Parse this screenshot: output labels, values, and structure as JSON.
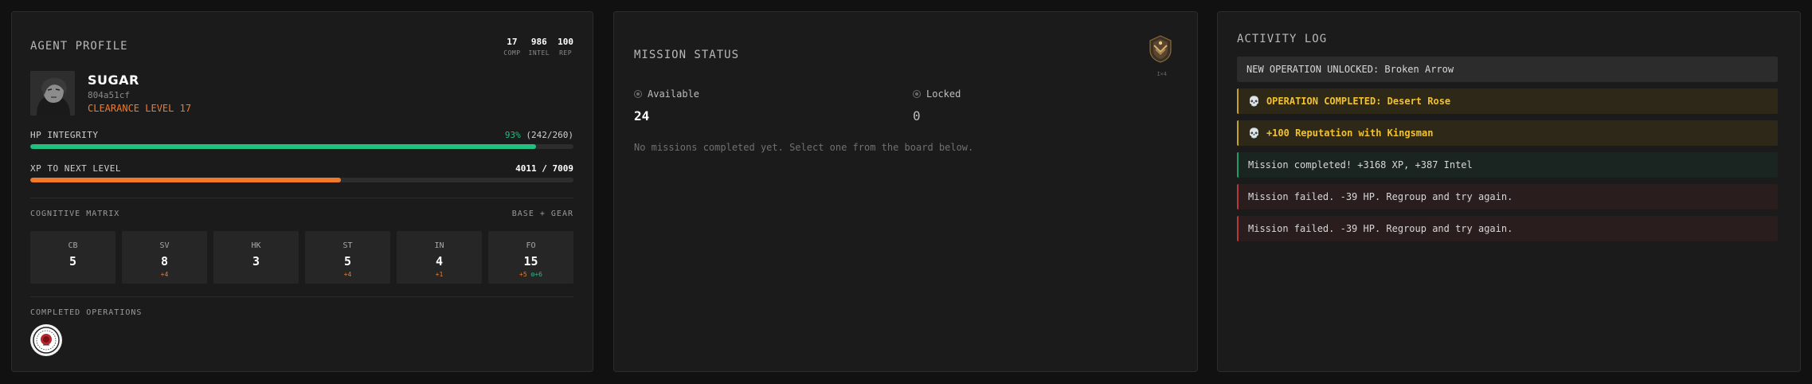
{
  "agent_profile": {
    "title": "AGENT PROFILE",
    "stats": [
      {
        "value": "17",
        "label": "COMP"
      },
      {
        "value": "986",
        "label": "INTEL"
      },
      {
        "value": "100",
        "label": "REP"
      }
    ],
    "name": "SUGAR",
    "agent_id": "804a51cf",
    "clearance": "CLEARANCE LEVEL 17",
    "hp": {
      "label": "HP INTEGRITY",
      "percent": "93%",
      "detail": "(242/260)",
      "fraction": 0.931
    },
    "xp": {
      "label": "XP TO NEXT LEVEL",
      "detail": "4011 / 7009",
      "fraction": 0.572
    },
    "matrix_label": "COGNITIVE MATRIX",
    "matrix_legend": "BASE + GEAR",
    "matrix": [
      {
        "code": "CB",
        "value": "5",
        "bonus": "",
        "gear": ""
      },
      {
        "code": "SV",
        "value": "8",
        "bonus": "+4",
        "gear": ""
      },
      {
        "code": "HK",
        "value": "3",
        "bonus": "",
        "gear": ""
      },
      {
        "code": "ST",
        "value": "5",
        "bonus": "+4",
        "gear": ""
      },
      {
        "code": "IN",
        "value": "4",
        "bonus": "+1",
        "gear": ""
      },
      {
        "code": "FO",
        "value": "15",
        "bonus": "+5",
        "gear": "+6"
      }
    ],
    "completed_label": "COMPLETED OPERATIONS",
    "colors": {
      "hp": "#1fc080",
      "xp": "#f07a2a",
      "accent": "#f07a2a"
    }
  },
  "mission_status": {
    "title": "MISSION STATUS",
    "insignia_tag": "I×4",
    "available_label": "Available",
    "available_count": "24",
    "locked_label": "Locked",
    "locked_count": "0",
    "note": "No missions completed yet. Select one from the board below."
  },
  "activity_log": {
    "title": "ACTIVITY LOG",
    "entries": [
      {
        "type": "neutral",
        "icon": "",
        "text": "NEW OPERATION UNLOCKED: Broken Arrow"
      },
      {
        "type": "gold",
        "icon": "💀",
        "text": "OPERATION COMPLETED: Desert Rose"
      },
      {
        "type": "gold",
        "icon": "💀",
        "text": "+100 Reputation with Kingsman"
      },
      {
        "type": "green",
        "icon": "",
        "text": "Mission completed! +3168 XP, +387 Intel"
      },
      {
        "type": "red",
        "icon": "",
        "text": "Mission failed. -39 HP. Regroup and try again."
      },
      {
        "type": "red",
        "icon": "",
        "text": "Mission failed. -39 HP. Regroup and try again."
      }
    ]
  }
}
